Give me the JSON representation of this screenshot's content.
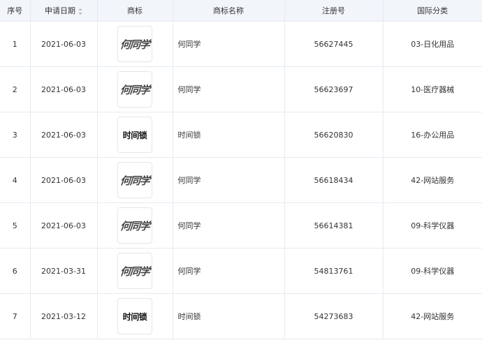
{
  "table": {
    "headers": {
      "index": "序号",
      "date": "申请日期",
      "logo": "商标",
      "name": "商标名称",
      "reg_no": "注册号",
      "intl_class": "国际分类"
    },
    "rows": [
      {
        "index": "1",
        "date": "2021-06-03",
        "logo_text": "何同学",
        "logo_style": "italic",
        "name": "何同学",
        "reg_no": "56627445",
        "intl_class": "03-日化用品"
      },
      {
        "index": "2",
        "date": "2021-06-03",
        "logo_text": "何同学",
        "logo_style": "italic",
        "name": "何同学",
        "reg_no": "56623697",
        "intl_class": "10-医疗器械"
      },
      {
        "index": "3",
        "date": "2021-06-03",
        "logo_text": "时间锁",
        "logo_style": "bold",
        "name": "时间锁",
        "reg_no": "56620830",
        "intl_class": "16-办公用品"
      },
      {
        "index": "4",
        "date": "2021-06-03",
        "logo_text": "何同学",
        "logo_style": "italic",
        "name": "何同学",
        "reg_no": "56618434",
        "intl_class": "42-网站服务"
      },
      {
        "index": "5",
        "date": "2021-06-03",
        "logo_text": "何同学",
        "logo_style": "italic",
        "name": "何同学",
        "reg_no": "56614381",
        "intl_class": "09-科学仪器"
      },
      {
        "index": "6",
        "date": "2021-03-31",
        "logo_text": "何同学",
        "logo_style": "italic",
        "name": "何同学",
        "reg_no": "54813761",
        "intl_class": "09-科学仪器"
      },
      {
        "index": "7",
        "date": "2021-03-12",
        "logo_text": "时间锁",
        "logo_style": "bold",
        "name": "时间锁",
        "reg_no": "54273683",
        "intl_class": "42-网站服务"
      }
    ]
  },
  "colors": {
    "header_bg": "#f2f6fb",
    "border": "#e4ebf2",
    "text": "#333333"
  },
  "icons": {
    "sort": "sort-arrows-icon"
  }
}
